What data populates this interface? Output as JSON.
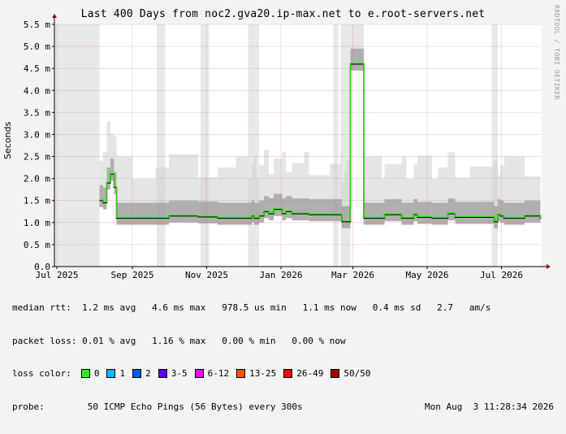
{
  "chart_data": {
    "type": "line",
    "title": "Last 400 Days from noc2.gva20.ip-max.net to e.root-servers.net",
    "side_label": "RRDTOOL / TOBI OETIKER",
    "ylabel": "Seconds",
    "ylim": [
      0,
      5.5
    ],
    "y_ticks": [
      {
        "value": 0.0,
        "label": "0.0"
      },
      {
        "value": 0.5,
        "label": "0.5 m"
      },
      {
        "value": 1.0,
        "label": "1.0 m"
      },
      {
        "value": 1.5,
        "label": "1.5 m"
      },
      {
        "value": 2.0,
        "label": "2.0 m"
      },
      {
        "value": 2.5,
        "label": "2.5 m"
      },
      {
        "value": 3.0,
        "label": "3.0 m"
      },
      {
        "value": 3.5,
        "label": "3.5 m"
      },
      {
        "value": 4.0,
        "label": "4.0 m"
      },
      {
        "value": 4.5,
        "label": "4.5 m"
      },
      {
        "value": 5.0,
        "label": "5.0 m"
      },
      {
        "value": 5.5,
        "label": "5.5 m"
      }
    ],
    "x_range": [
      "2025-06-29",
      "2026-08-03"
    ],
    "x_ticks": [
      {
        "date": "2025-07-01",
        "label": "Jul 2025"
      },
      {
        "date": "2025-09-01",
        "label": "Sep 2025"
      },
      {
        "date": "2025-11-01",
        "label": "Nov 2025"
      },
      {
        "date": "2026-01-01",
        "label": "Jan 2026"
      },
      {
        "date": "2026-03-01",
        "label": "Mar 2026"
      },
      {
        "date": "2026-05-01",
        "label": "May 2026"
      },
      {
        "date": "2026-07-01",
        "label": "Jul 2026"
      }
    ],
    "grid": true,
    "unknown_periods": [
      [
        "2025-06-29",
        "2025-08-05"
      ],
      [
        "2025-09-21",
        "2025-09-28"
      ],
      [
        "2025-10-27",
        "2025-11-03"
      ],
      [
        "2025-12-05",
        "2025-12-14"
      ],
      [
        "2026-02-13",
        "2026-02-17"
      ],
      [
        "2026-02-19",
        "2026-02-27"
      ],
      [
        "2026-06-23",
        "2026-06-28"
      ]
    ],
    "series": [
      {
        "x": [
          "2025-08-05",
          "2025-08-08",
          "2025-08-11",
          "2025-08-14",
          "2025-08-17",
          "2025-08-19",
          "2025-09-01",
          "2025-09-20",
          "2025-10-01",
          "2025-10-25",
          "2025-11-10",
          "2025-11-25",
          "2025-12-05",
          "2025-12-08",
          "2025-12-10",
          "2025-12-12",
          "2025-12-14",
          "2025-12-18",
          "2025-12-22",
          "2025-12-26",
          "2026-01-02",
          "2026-01-05",
          "2026-01-10",
          "2026-01-20",
          "2026-01-24",
          "2026-02-10",
          "2026-02-19",
          "2026-02-20",
          "2026-02-22",
          "2026-02-24",
          "2026-02-26",
          "2026-02-27",
          "2026-03-10",
          "2026-03-25",
          "2026-03-27",
          "2026-04-10",
          "2026-04-14",
          "2026-04-20",
          "2026-04-23",
          "2026-05-05",
          "2026-05-10",
          "2026-05-18",
          "2026-05-24",
          "2026-06-05",
          "2026-06-25",
          "2026-06-28",
          "2026-06-30",
          "2026-07-03",
          "2026-07-20",
          "2026-08-02"
        ],
        "values": [
          1.5,
          1.45,
          1.9,
          2.1,
          1.8,
          1.1,
          1.1,
          1.1,
          1.15,
          1.13,
          1.1,
          1.1,
          1.1,
          1.15,
          1.1,
          1.1,
          1.15,
          1.25,
          1.2,
          1.3,
          1.2,
          1.25,
          1.2,
          1.2,
          1.18,
          1.18,
          1.18,
          1.02,
          1.02,
          1.02,
          1.02,
          4.6,
          1.1,
          1.1,
          1.18,
          1.1,
          1.1,
          1.18,
          1.12,
          1.1,
          1.1,
          1.2,
          1.12,
          1.12,
          1.02,
          1.18,
          1.15,
          1.1,
          1.15,
          1.08
        ]
      }
    ],
    "stats": {
      "median_rtt": "median rtt:  1.2 ms avg   4.6 ms max   978.5 us min   1.1 ms now   0.4 ms sd   2.7   am/s",
      "packet_loss": "packet loss: 0.01 % avg   1.16 % max   0.00 % min   0.00 % now",
      "loss_color_label": "loss color:",
      "loss_colors": [
        {
          "label": "0",
          "color": "#26ff00"
        },
        {
          "label": "1",
          "color": "#00b8ff"
        },
        {
          "label": "2",
          "color": "#0059ff"
        },
        {
          "label": "3-5",
          "color": "#5e00ff"
        },
        {
          "label": "6-12",
          "color": "#ff00ff"
        },
        {
          "label": "13-25",
          "color": "#ff5500"
        },
        {
          "label": "26-49",
          "color": "#ff0000"
        },
        {
          "label": "50/50",
          "color": "#a10000"
        }
      ],
      "probe": "probe:        50 ICMP Echo Pings (56 Bytes) every 300s",
      "timestamp": "Mon Aug  3 11:28:34 2026"
    }
  }
}
